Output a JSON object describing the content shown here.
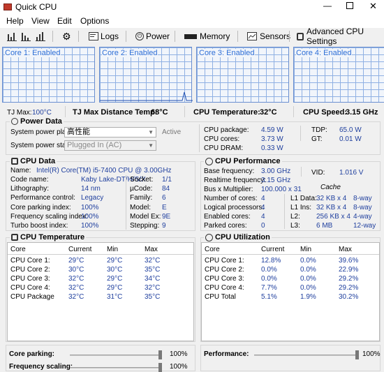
{
  "window": {
    "title": "Quick CPU"
  },
  "menu": [
    "Help",
    "View",
    "Edit",
    "Options"
  ],
  "toolbar": {
    "logs": "Logs",
    "power": "Power",
    "memory": "Memory",
    "sensors": "Sensors",
    "adv": "Advanced CPU Settings"
  },
  "cores_graph": [
    {
      "label": "Core 1: Enabled"
    },
    {
      "label": "Core 2: Enabled"
    },
    {
      "label": "Core 3: Enabled"
    },
    {
      "label": "Core 4: Enabled"
    }
  ],
  "status": {
    "tjmax_l": "TJ Max:",
    "tjmax_v": "100°C",
    "tjdist_l": "TJ Max Distance Temp:",
    "tjdist_v": "68°C",
    "temp_l": "CPU Temperature:",
    "temp_v": "32°C",
    "speed_l": "CPU Speed:",
    "speed_v": "3.15 GHz"
  },
  "power_data": {
    "title": "Power Data",
    "plan_l": "System power plan:",
    "plan_v": "高性能",
    "plan_state": "Active",
    "state_l": "System power state:",
    "state_v": "Plugged In (AC)",
    "pkg_l": "CPU package:",
    "pkg_v": "4.59 W",
    "cores_l": "CPU cores:",
    "cores_v": "3.73 W",
    "dram_l": "CPU DRAM:",
    "dram_v": "0.33 W",
    "tdp_l": "TDP:",
    "tdp_v": "65.0 W",
    "gt_l": "GT:",
    "gt_v": "0.01 W"
  },
  "cpu_data": {
    "title": "CPU Data",
    "name_l": "Name:",
    "name_v": "Intel(R) Core(TM) i5-7400 CPU @ 3.00GHz",
    "rows": [
      {
        "l": "Code name:",
        "v": "Kaby Lake-DT/H/S/X",
        "l2": "Socket:",
        "v2": "1/1"
      },
      {
        "l": "Lithography:",
        "v": "14 nm",
        "l2": "µCode:",
        "v2": "84"
      },
      {
        "l": "Performance control:",
        "v": "Legacy",
        "l2": "Family:",
        "v2": "6"
      },
      {
        "l": "Core parking index:",
        "v": "100%",
        "l2": "Model:",
        "v2": "E"
      },
      {
        "l": "Frequency scaling index:",
        "v": "100%",
        "l2": "Model Ex:",
        "v2": "9E"
      },
      {
        "l": "Turbo boost index:",
        "v": "100%",
        "l2": "Stepping:",
        "v2": "9"
      }
    ]
  },
  "cpu_perf": {
    "title": "CPU Performance",
    "base_l": "Base frequency:",
    "base_v": "3.00 GHz",
    "real_l": "Realtime frequency:",
    "real_v": "3.15 GHz",
    "vid_l": "VID:",
    "vid_v": "1.016 V",
    "bus_l": "Bus x Multiplier:",
    "bus_v": "100.000 x 31",
    "cache_l": "Cache",
    "rows": [
      {
        "l": "Number of cores:",
        "v": "4",
        "c": "L1 Data:",
        "cs": "32 KB x 4",
        "w": "8-way"
      },
      {
        "l": "Logical processors:",
        "v": "4",
        "c": "L1 Ins:",
        "cs": "32 KB x 4",
        "w": "8-way"
      },
      {
        "l": "Enabled cores:",
        "v": "4",
        "c": "L2:",
        "cs": "256 KB x 4",
        "w": "4-way"
      },
      {
        "l": "Parked cores:",
        "v": "0",
        "c": "L3:",
        "cs": "6 MB",
        "w": "12-way"
      }
    ]
  },
  "cpu_temp": {
    "title": "CPU Temperature",
    "cols": [
      "Core",
      "Current",
      "Min",
      "Max"
    ],
    "rows": [
      [
        "CPU Core 1:",
        "29°C",
        "29°C",
        "32°C"
      ],
      [
        "CPU Core 2:",
        "30°C",
        "30°C",
        "35°C"
      ],
      [
        "CPU Core 3:",
        "32°C",
        "29°C",
        "34°C"
      ],
      [
        "CPU Core 4:",
        "32°C",
        "29°C",
        "32°C"
      ],
      [
        "CPU Package",
        "32°C",
        "31°C",
        "35°C"
      ]
    ]
  },
  "cpu_util": {
    "title": "CPU Utilization",
    "cols": [
      "Core",
      "Current",
      "Min",
      "Max"
    ],
    "rows": [
      [
        "CPU Core 1:",
        "12.8%",
        "0.0%",
        "39.6%"
      ],
      [
        "CPU Core 2:",
        "0.0%",
        "0.0%",
        "22.9%"
      ],
      [
        "CPU Core 3:",
        "0.0%",
        "0.0%",
        "29.2%"
      ],
      [
        "CPU Core 4:",
        "7.7%",
        "0.0%",
        "29.2%"
      ],
      [
        "CPU Total",
        "5.1%",
        "1.9%",
        "30.2%"
      ]
    ]
  },
  "sliders": {
    "parking_l": "Core parking:",
    "parking_v": "100%",
    "parking_level": 1.0,
    "freq_l": "Frequency scaling:",
    "freq_v": "100%",
    "freq_level": 1.0,
    "perf_l": "Performance:",
    "perf_v": "100%",
    "perf_level": 1.0
  }
}
